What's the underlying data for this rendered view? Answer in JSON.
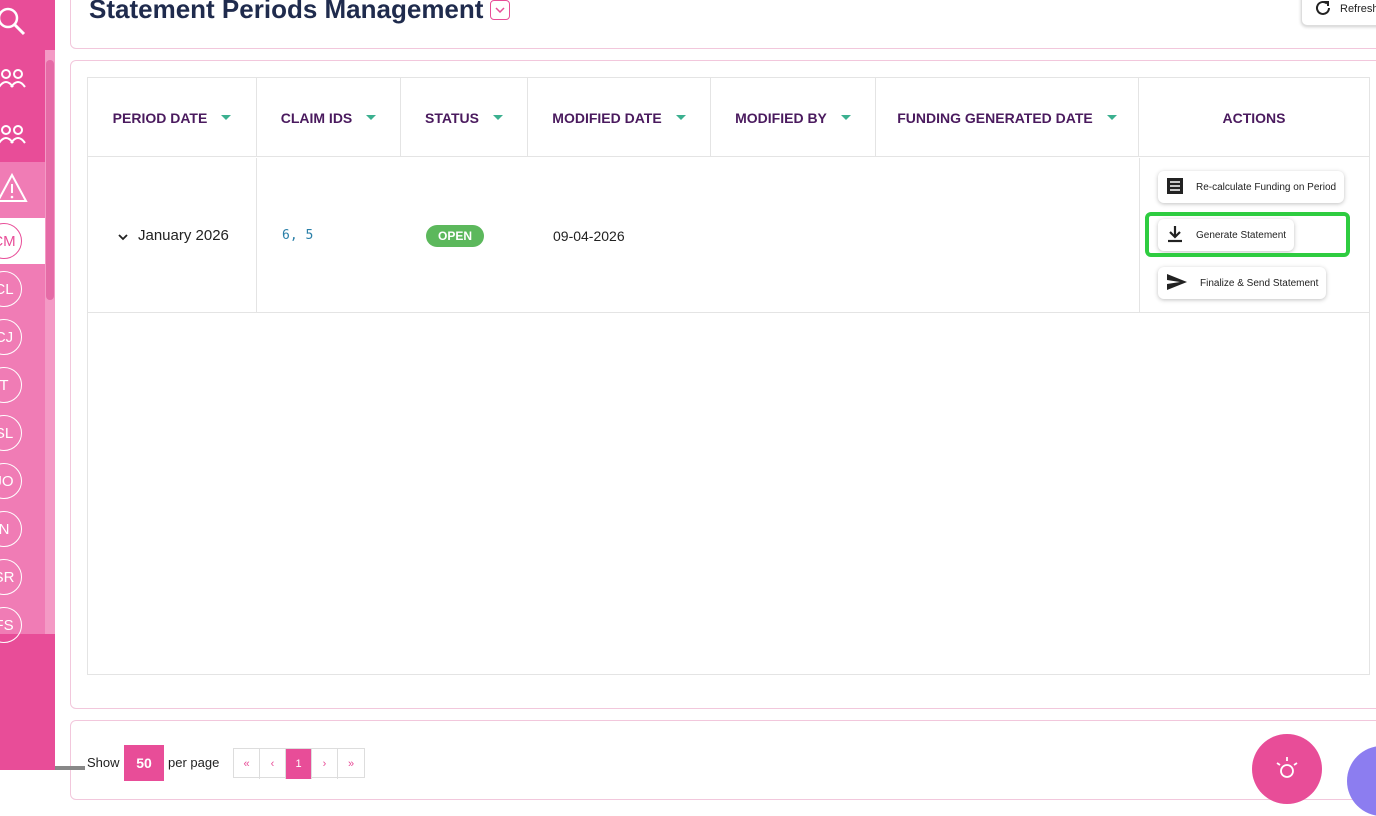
{
  "header": {
    "title": "Statement Periods Management",
    "refresh_label": "Refresh"
  },
  "sidebar": {
    "circles": [
      "CM",
      "CL",
      "CJ",
      "T",
      "SL",
      "JO",
      "N",
      "SR",
      "FS"
    ]
  },
  "table": {
    "columns": [
      {
        "label": "PERIOD DATE"
      },
      {
        "label": "CLAIM IDS"
      },
      {
        "label": "STATUS"
      },
      {
        "label": "MODIFIED DATE"
      },
      {
        "label": "MODIFIED BY"
      },
      {
        "label": "FUNDING GENERATED DATE"
      },
      {
        "label": "ACTIONS"
      }
    ],
    "rows": [
      {
        "period_date": "January 2026",
        "claim_ids": "6, 5",
        "status": "OPEN",
        "modified_date": "09-04-2026",
        "modified_by": "",
        "funding_generated_date": ""
      }
    ],
    "actions": {
      "recalculate": "Re-calculate Funding on Period",
      "generate": "Generate Statement",
      "finalize": "Finalize & Send Statement"
    }
  },
  "pagination": {
    "show_label": "Show",
    "page_size": "50",
    "per_page_label": "per page",
    "first": "«",
    "prev": "‹",
    "current": "1",
    "next": "›",
    "last": "»"
  },
  "colors": {
    "brand": "#e84d98",
    "status_open": "#5cb85c",
    "highlight": "#2ecc40"
  }
}
